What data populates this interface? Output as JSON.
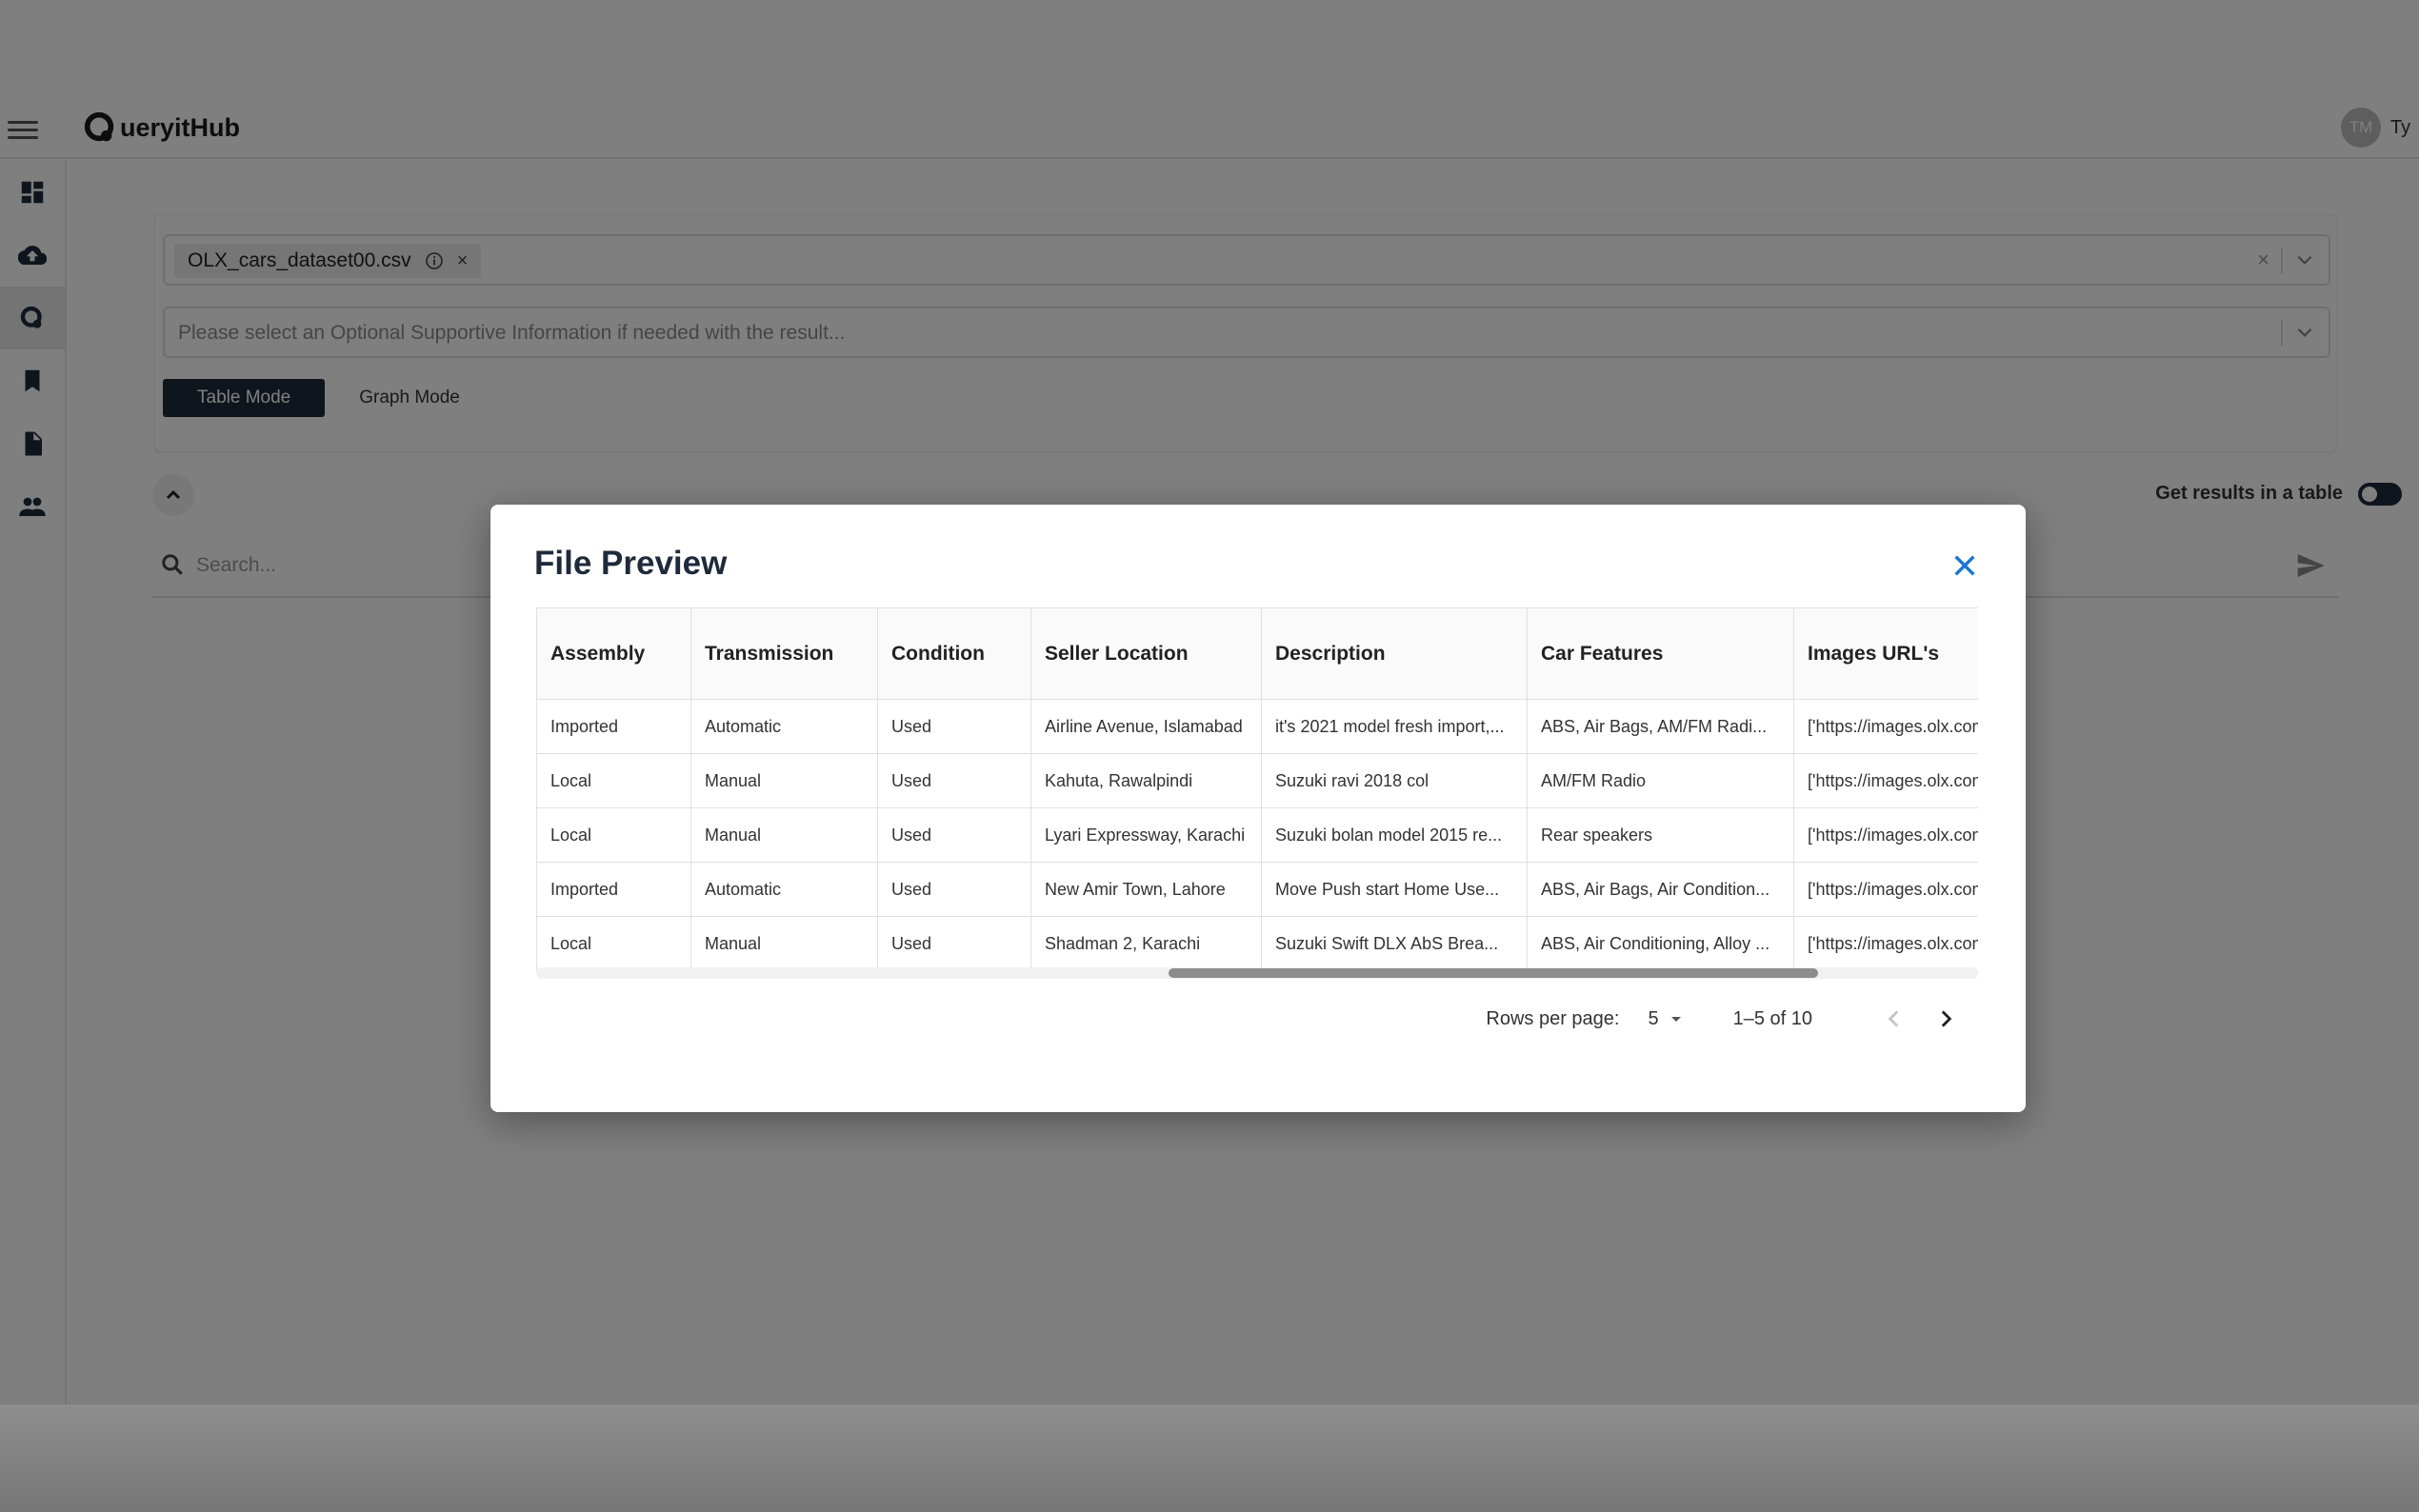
{
  "app": {
    "logo_text": "ueryitHub",
    "user_initials": "TM",
    "user_name_partial": "Ty"
  },
  "sidebar": {
    "items": [
      {
        "icon": "dashboard-icon"
      },
      {
        "icon": "cloud-upload-icon"
      },
      {
        "icon": "query-icon",
        "active": true
      },
      {
        "icon": "bookmark-icon"
      },
      {
        "icon": "document-icon"
      },
      {
        "icon": "people-icon"
      }
    ]
  },
  "query_panel": {
    "file_chip": "OLX_cars_dataset00.csv",
    "chip_close": "×",
    "clear": "×",
    "supportive_placeholder": "Please select an Optional Supportive Information if needed with the result...",
    "table_mode": "Table Mode",
    "graph_mode": "Graph Mode",
    "table_toggle_label": "Get results in a table",
    "search_placeholder": "Search..."
  },
  "modal": {
    "title": "File Preview",
    "columns": [
      "Assembly",
      "Transmission",
      "Condition",
      "Seller Location",
      "Description",
      "Car Features",
      "Images URL's"
    ],
    "rows": [
      [
        "Imported",
        "Automatic",
        "Used",
        "Airline Avenue, Islamabad",
        "it's 2021 model fresh import,...",
        "ABS, Air Bags, AM/FM Radi...",
        "['https://images.olx.com"
      ],
      [
        "Local",
        "Manual",
        "Used",
        "Kahuta, Rawalpindi",
        "Suzuki ravi 2018 col",
        "AM/FM Radio",
        "['https://images.olx.com"
      ],
      [
        "Local",
        "Manual",
        "Used",
        "Lyari Expressway, Karachi",
        "Suzuki bolan model 2015 re...",
        "Rear speakers",
        "['https://images.olx.com"
      ],
      [
        "Imported",
        "Automatic",
        "Used",
        "New Amir Town, Lahore",
        "Move Push start Home Use...",
        "ABS, Air Bags, Air Condition...",
        "['https://images.olx.com"
      ],
      [
        "Local",
        "Manual",
        "Used",
        "Shadman 2, Karachi",
        "Suzuki Swift DLX AbS Brea...",
        "ABS, Air Conditioning, Alloy ...",
        "['https://images.olx.com"
      ]
    ],
    "pagination": {
      "rows_per_page_label": "Rows per page:",
      "rows_per_page": "5",
      "range": "1–5 of 10"
    }
  }
}
